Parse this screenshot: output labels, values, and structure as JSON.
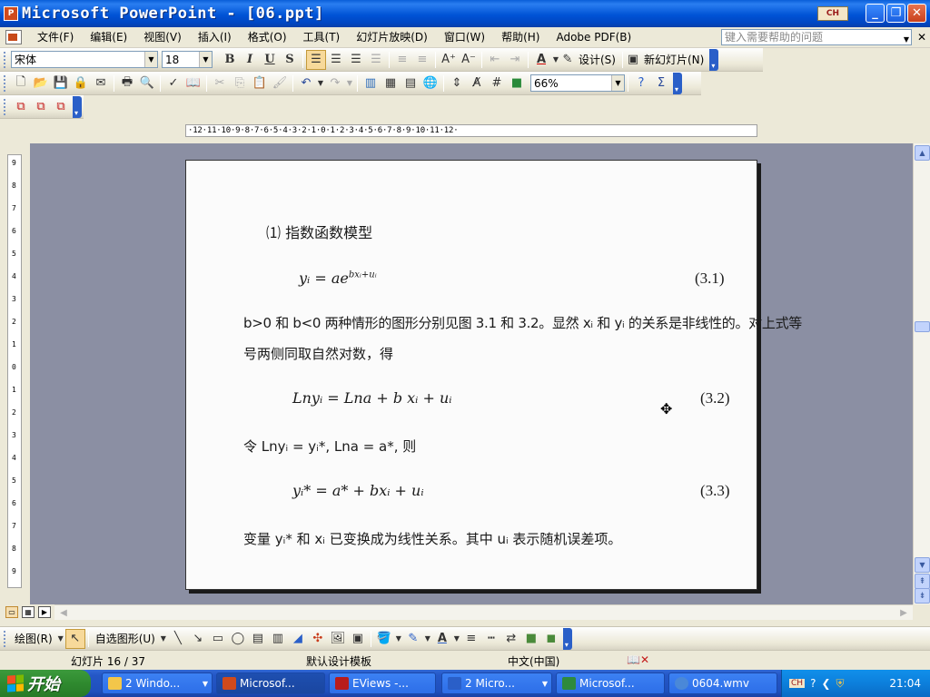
{
  "window": {
    "title": "Microsoft PowerPoint - [06.ppt]",
    "app_icon": "P",
    "lang_badge": "CH"
  },
  "menu": {
    "items": [
      "文件(F)",
      "编辑(E)",
      "视图(V)",
      "插入(I)",
      "格式(O)",
      "工具(T)",
      "幻灯片放映(D)",
      "窗口(W)",
      "帮助(H)",
      "Adobe PDF(B)"
    ],
    "help_placeholder": "键入需要帮助的问题"
  },
  "format_toolbar": {
    "font": "宋体",
    "size": "18",
    "bold": "B",
    "italic": "I",
    "underline": "U",
    "shadow": "S",
    "design_label": "设计(S)",
    "new_slide_label": "新幻灯片(N)"
  },
  "standard_toolbar": {
    "zoom": "66%"
  },
  "ruler": {
    "horizontal": "·12·11·10·9·8·7·6·5·4·3·2·1·0·1·2·3·4·5·6·7·8·9·10·11·12·",
    "vertical": [
      "9",
      "8",
      "7",
      "6",
      "5",
      "4",
      "3",
      "2",
      "1",
      "0",
      "1",
      "2",
      "3",
      "4",
      "5",
      "6",
      "7",
      "8",
      "9"
    ]
  },
  "slide": {
    "heading": "⑴ 指数函数模型",
    "eq1": "yᵢ =  ae",
    "eq1_exp": "bxᵢ+uᵢ",
    "eq1_no": "(3.1)",
    "para1_line1": "b>0 和 b<0 两种情形的图形分别见图 3.1 和 3.2。显然 xᵢ 和 yᵢ 的关系是非线性的。对上式等",
    "para1_line2": "号两侧同取自然对数，得",
    "eq2": "Lnyᵢ = Lna + b xᵢ + uᵢ",
    "eq2_no": "(3.2)",
    "para2": "令 Lnyᵢ = yᵢ*, Lna = a*,  则",
    "eq3": "yᵢ* = a* + bxᵢ + uᵢ",
    "eq3_no": "(3.3)",
    "para3": "变量 yᵢ* 和 xᵢ 已变换成为线性关系。其中 uᵢ 表示随机误差项。"
  },
  "drawing_toolbar": {
    "draw_label": "绘图(R)",
    "autoshapes_label": "自选图形(U)"
  },
  "status": {
    "slide_pos": "幻灯片 16 / 37",
    "template": "默认设计模板",
    "language": "中文(中国)"
  },
  "taskbar": {
    "start_label": "开始",
    "tasks": [
      {
        "label": "2 Windo...",
        "color": "#f3c64a"
      },
      {
        "label": "Microsof...",
        "color": "#d04a1c"
      },
      {
        "label": "EViews -...",
        "color": "#b81c1c"
      },
      {
        "label": "2 Micro...",
        "color": "#2a5fc8"
      },
      {
        "label": "Microsof...",
        "color": "#2e8a3c"
      },
      {
        "label": "0604.wmv",
        "color": "#4a88d8"
      }
    ],
    "clock": "21:04"
  }
}
